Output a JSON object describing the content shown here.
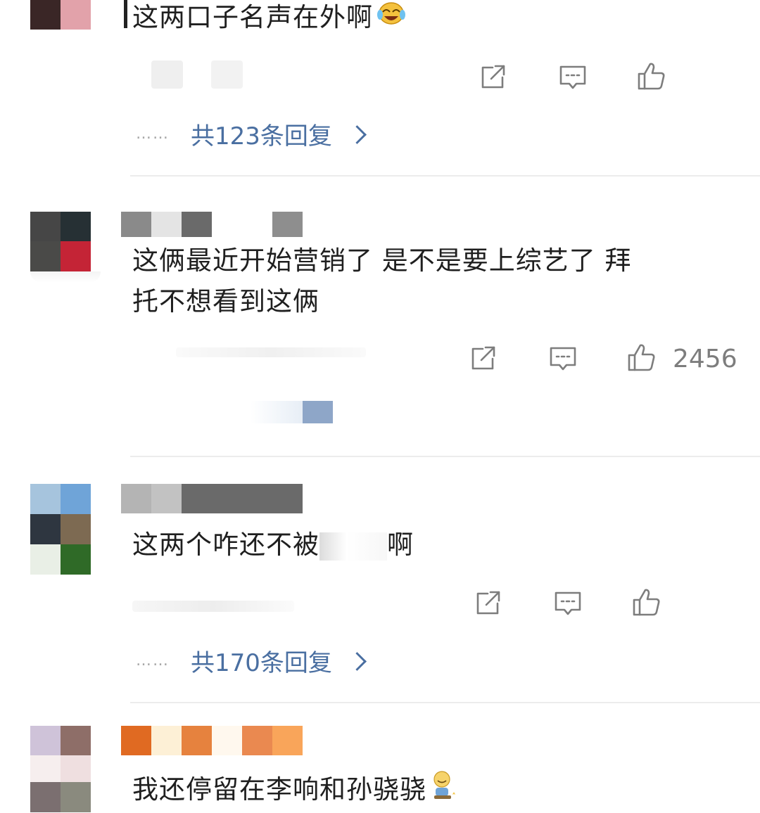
{
  "comments": [
    {
      "text": "这两口子名声在外啊",
      "emoji": "laughing-crying-emoji",
      "replies_label": "共123条回复",
      "reply_dots": "……"
    },
    {
      "text_line1": "这俩最近开始营销了 是不是要上综艺了 拜",
      "text_line2": "托不想看到这俩",
      "like_count": "2456"
    },
    {
      "text_visible_a": "这两个咋还不被",
      "text_visible_b": "啊",
      "replies_label": "共170条回复",
      "reply_dots": "……"
    },
    {
      "text": "我还停留在李响和孙骁骁",
      "emoji": "sitting-pray-emoji"
    }
  ],
  "icons": {
    "share": "share-icon",
    "comment": "comment-icon",
    "like": "thumbs-up-icon"
  },
  "colors": {
    "reply_link": "#4a6fa1",
    "icon_gray": "#7d7d7d",
    "divider": "#ececec"
  }
}
